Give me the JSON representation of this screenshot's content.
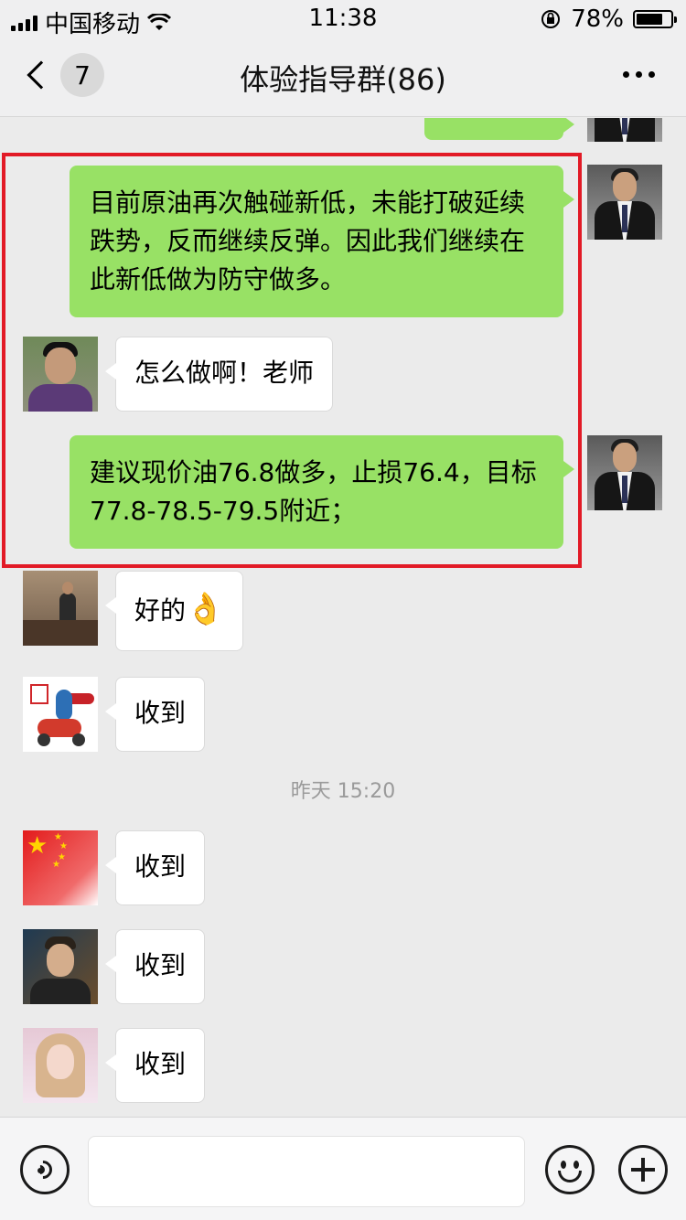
{
  "status_bar": {
    "carrier": "中国移动",
    "time": "11:38",
    "battery_percent_text": "78%",
    "battery_level": 0.78
  },
  "nav": {
    "unread_count": "7",
    "title": "体验指导群(86)"
  },
  "messages": [
    {
      "side": "right",
      "avatar": "suit-man",
      "text": "目前原油再次触碰新低，未能打破延续跌势，反而继续反弹。因此我们继续在此新低做为防守做多。"
    },
    {
      "side": "left",
      "avatar": "young-man",
      "text": "怎么做啊！老师"
    },
    {
      "side": "right",
      "avatar": "suit-man",
      "text": "建议现价油76.8做多，止损76.4，目标77.8-78.5-79.5附近；"
    },
    {
      "side": "left",
      "avatar": "office-man",
      "text": "好的",
      "emoji": "👌"
    },
    {
      "side": "left",
      "avatar": "scooter-hero",
      "text": "收到"
    },
    {
      "side": "left",
      "avatar": "flag",
      "text": "收到"
    },
    {
      "side": "left",
      "avatar": "guy-selfie",
      "text": "收到"
    },
    {
      "side": "left",
      "avatar": "girl",
      "text": "收到"
    }
  ],
  "timestamp": "昨天 15:20",
  "icons": {
    "back": "chevron-left-icon",
    "more": "more-dots-icon",
    "voice": "voice-icon",
    "emoji": "emoji-icon",
    "plus": "plus-icon",
    "wifi": "wifi-icon",
    "lock": "rotation-lock-icon",
    "battery": "battery-icon"
  },
  "colors": {
    "outgoing_bubble": "#98e165",
    "incoming_bubble": "#ffffff",
    "highlight_border": "#e21a26",
    "chat_background": "#ebebeb"
  }
}
